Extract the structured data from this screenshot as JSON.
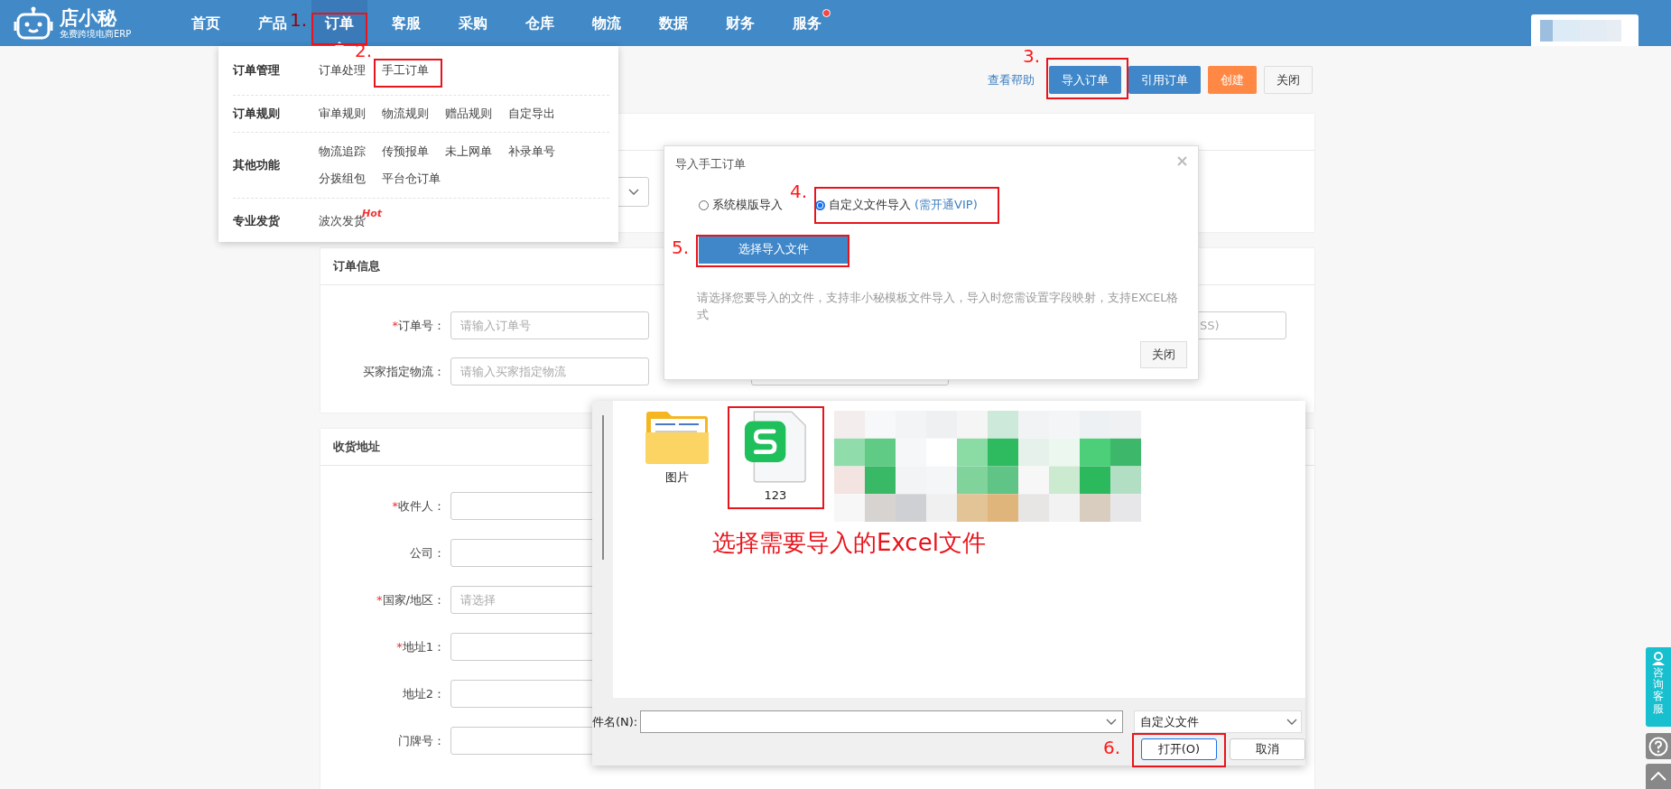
{
  "header": {
    "logo": {
      "name": "店小秘",
      "tagline": "免费跨境电商ERP"
    },
    "nav": [
      {
        "label": "首页",
        "selected": false,
        "dot": false
      },
      {
        "label": "产品",
        "selected": false,
        "dot": false
      },
      {
        "label": "订单",
        "selected": true,
        "dot": false
      },
      {
        "label": "客服",
        "selected": false,
        "dot": false
      },
      {
        "label": "采购",
        "selected": false,
        "dot": false
      },
      {
        "label": "仓库",
        "selected": false,
        "dot": false
      },
      {
        "label": "物流",
        "selected": false,
        "dot": false
      },
      {
        "label": "数据",
        "selected": false,
        "dot": false
      },
      {
        "label": "财务",
        "selected": false,
        "dot": false
      },
      {
        "label": "服务",
        "selected": false,
        "dot": true
      }
    ]
  },
  "toolbar": {
    "help_link": "查看帮助",
    "buttons": [
      {
        "label": "导入订单",
        "kind": "primary"
      },
      {
        "label": "引用订单",
        "kind": "primary"
      },
      {
        "label": "创建",
        "kind": "warning"
      },
      {
        "label": "关闭",
        "kind": "default"
      }
    ]
  },
  "order_menu": {
    "groups": [
      {
        "title": "订单管理",
        "links": [
          {
            "label": "订单处理"
          },
          {
            "label": "手工订单"
          }
        ]
      },
      {
        "title": "订单规则",
        "links": [
          {
            "label": "审单规则"
          },
          {
            "label": "物流规则"
          },
          {
            "label": "赠品规则"
          },
          {
            "label": "自定导出"
          }
        ]
      },
      {
        "title": "其他功能",
        "links": [
          {
            "label": "物流追踪"
          },
          {
            "label": "传预报单"
          },
          {
            "label": "未上网单"
          },
          {
            "label": "补录单号"
          },
          {
            "label": "分拨组包"
          },
          {
            "label": "平台仓订单"
          }
        ]
      },
      {
        "title": "专业发货",
        "links": [
          {
            "label": "波次发货",
            "tag": "Hot"
          }
        ]
      }
    ]
  },
  "order_info": {
    "title": "订单信息",
    "fields": [
      {
        "mark": "*",
        "label": "订单号：",
        "placeholder": "请输入订单号"
      },
      {
        "label": "买家指定物流：",
        "placeholder": "请输入买家指定物流"
      }
    ],
    "column_3_field": {
      "placeholder": "SS)"
    }
  },
  "shipping_address": {
    "title": "收货地址",
    "fields": [
      {
        "mark": "*",
        "label": "收件人："
      },
      {
        "label": "公司："
      },
      {
        "mark": "*",
        "label": "国家/地区：",
        "placeholder": "请选择"
      },
      {
        "mark": "*",
        "label": "地址1："
      },
      {
        "label": "地址2："
      },
      {
        "label": "门牌号："
      }
    ]
  },
  "import_dialog": {
    "title": "导入手工订单",
    "options": [
      {
        "label": "系统模版导入",
        "selected": false
      },
      {
        "label": "自定义文件导入",
        "note": "(需开通VIP)",
        "selected": true
      }
    ],
    "choose_button": "选择导入文件",
    "hint": "请选择您要导入的文件，支持非小秘模板文件导入，导入时您需设置字段映射，支持EXCEL格式",
    "close_button": "关闭"
  },
  "file_dialog": {
    "items": [
      {
        "name": "图片",
        "kind": "folder"
      },
      {
        "name": "123",
        "kind": "spreadsheet"
      }
    ],
    "filename_label": "件名(N):",
    "file_type": "自定义文件",
    "buttons": [
      {
        "label": "打开(O)",
        "kind": "default"
      },
      {
        "label": "取消",
        "kind": "normal"
      }
    ]
  },
  "annotations": {
    "steps": [
      "1.",
      "2.",
      "3.",
      "4.",
      "5.",
      "6."
    ],
    "caption": "选择需要导入的Excel文件"
  },
  "side_float": {
    "consult": "咨询客服"
  }
}
